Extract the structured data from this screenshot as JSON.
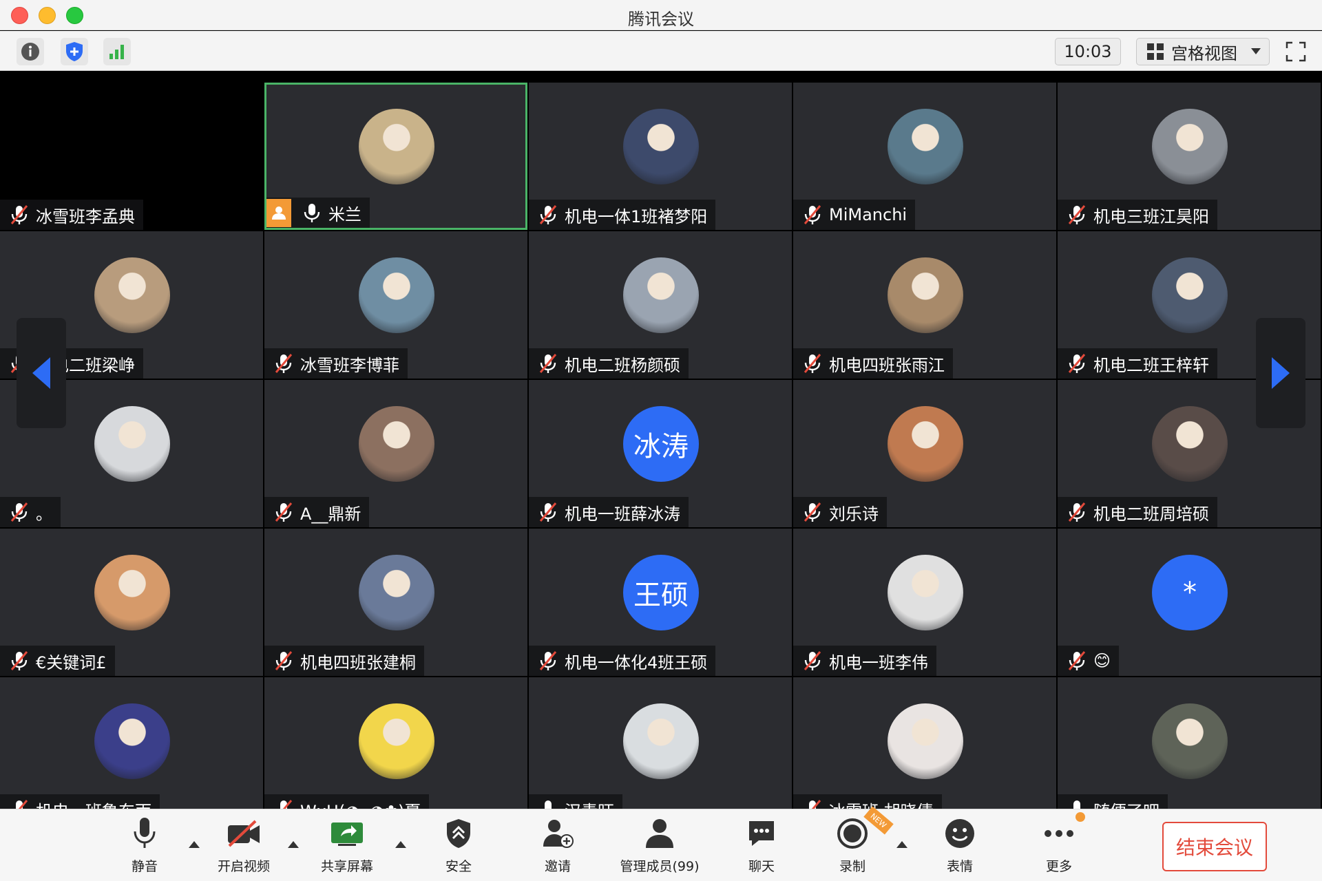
{
  "window": {
    "title": "腾讯会议"
  },
  "toolbar": {
    "info_icon": "info-icon",
    "security_icon": "shield-plus-icon",
    "network_icon": "signal-bars-icon",
    "time": "10:03",
    "view_mode": "宫格视图",
    "fullscreen_icon": "fullscreen-icon"
  },
  "colors": {
    "accent_blue": "#2d6cf5",
    "active_speaker_border": "#4ab467",
    "host_badge": "#f39a36",
    "end_meeting": "#e34a3b",
    "tile_bg": "#2b2c30"
  },
  "participants": [
    {
      "name": "冰雪班李孟典",
      "muted": true,
      "video": "black"
    },
    {
      "name": "米兰",
      "muted": false,
      "host": true,
      "active": true,
      "avatar_text": ""
    },
    {
      "name": "机电一体1班褚梦阳",
      "muted": true
    },
    {
      "name": "MiManchi",
      "muted": true
    },
    {
      "name": "机电三班江昊阳",
      "muted": true
    },
    {
      "name": "机电二班梁峥",
      "muted": true
    },
    {
      "name": "冰雪班李博菲",
      "muted": true
    },
    {
      "name": "机电二班杨颜硕",
      "muted": true
    },
    {
      "name": "机电四班张雨江",
      "muted": true
    },
    {
      "name": "机电二班王梓轩",
      "muted": true
    },
    {
      "name": "。",
      "muted": true
    },
    {
      "name": "A__鼎新",
      "muted": true
    },
    {
      "name": "机电一班薛冰涛",
      "muted": true,
      "avatar_text": "冰涛"
    },
    {
      "name": "刘乐诗",
      "muted": true
    },
    {
      "name": "机电二班周培硕",
      "muted": true
    },
    {
      "name": "€关键词£",
      "muted": true
    },
    {
      "name": "机电四班张建桐",
      "muted": true
    },
    {
      "name": "机电一体化4班王硕",
      "muted": true,
      "avatar_text": "王硕"
    },
    {
      "name": "机电一班李伟",
      "muted": true
    },
    {
      "name": "😊",
      "muted": true,
      "avatar_text": "*"
    },
    {
      "name": "机电一班鲁东雨",
      "muted": true
    },
    {
      "name": "WxH(◕ᴗ◕✿)夏",
      "muted": true
    },
    {
      "name": "汉青旺",
      "muted": false
    },
    {
      "name": "冰雪班 胡晓倩",
      "muted": true
    },
    {
      "name": "随便了吧",
      "muted": false
    }
  ],
  "controls": {
    "mute": "静音",
    "video": "开启视频",
    "share": "共享屏幕",
    "security": "安全",
    "invite": "邀请",
    "members": "管理成员(99)",
    "chat": "聊天",
    "record": "录制",
    "record_badge": "NEW",
    "reactions": "表情",
    "more": "更多",
    "end": "结束会议"
  }
}
